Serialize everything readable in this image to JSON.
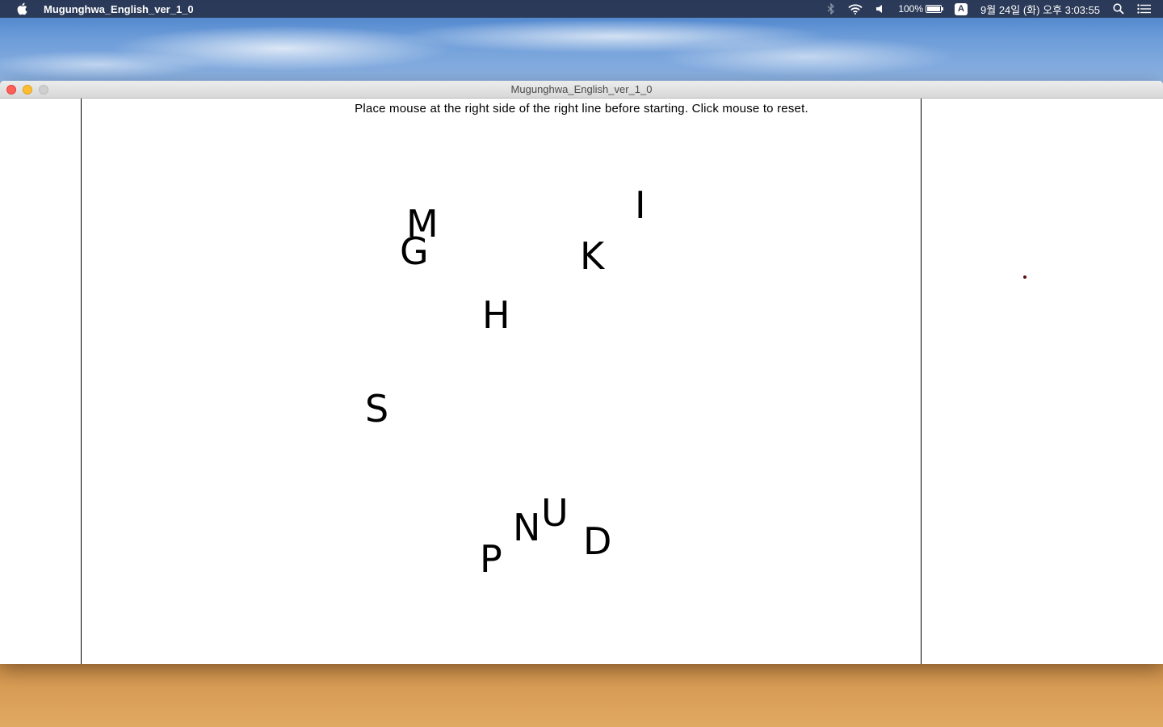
{
  "menubar": {
    "app_name": "Mugunghwa_English_ver_1_0",
    "battery": "100%",
    "input_source": "A",
    "datetime": "9월 24일 (화) 오후 3:03:55",
    "icons": [
      "apple-icon",
      "bluetooth-icon",
      "wifi-icon",
      "volume-icon",
      "battery-icon",
      "input-source-icon",
      "spotlight-icon",
      "notification-center-icon"
    ]
  },
  "window": {
    "title": "Mugunghwa_English_ver_1_0",
    "instruction": "Place mouse at the right side of the right line before starting. Click mouse to reset.",
    "letters": {
      "m": "M",
      "g": "G",
      "i": "I",
      "k": "K",
      "h": "H",
      "s": "S",
      "p": "P",
      "n": "N",
      "u": "U",
      "d": "D"
    }
  }
}
